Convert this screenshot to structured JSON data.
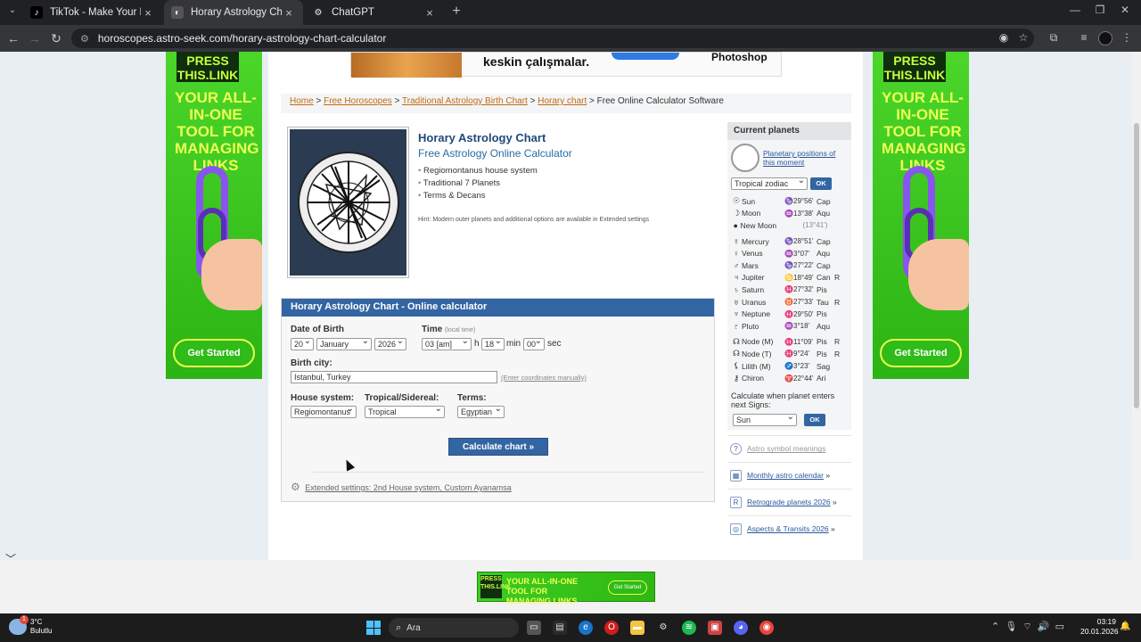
{
  "browser": {
    "tabs": [
      {
        "title": "TikTok - Make Your Day",
        "active": false
      },
      {
        "title": "Horary Astrology Chart Calculat",
        "active": true
      },
      {
        "title": "ChatGPT",
        "active": false
      }
    ],
    "url": "horoscopes.astro-seek.com/horary-astrology-chart-calculator"
  },
  "ads": {
    "side_brand": "PRESS THIS.LINK",
    "side_slogan": "YOUR ALL-IN-ONE TOOL FOR MANAGING LINKS",
    "side_cta": "Get Started",
    "top_text": "keskin çalışmalar.",
    "top_product": "Photoshop",
    "bottom_brand": "PRESS THIS.LINK",
    "bottom_slogan": "YOUR ALL-IN-ONE TOOL FOR MANAGING LINKS",
    "bottom_cta": "Get Started"
  },
  "breadcrumb": {
    "items": [
      "Home",
      "Free Horoscopes",
      "Traditional Astrology Birth Chart",
      "Horary chart"
    ],
    "current": "Free Online Calculator Software",
    "separator": ">"
  },
  "intro": {
    "title": "Horary Astrology Chart",
    "subtitle": "Free Astrology Online Calculator",
    "features": [
      "Regiomontanus house system",
      "Traditional 7 Planets",
      "Terms & Decans"
    ],
    "hint": "Hint: Modern outer planets and additional options are available in Extended settings"
  },
  "calculator": {
    "header": "Horary Astrology Chart - Online calculator",
    "date_label": "Date of Birth",
    "day": "20",
    "month": "January",
    "year": "2026",
    "time_label": "Time",
    "time_note": "(local time)",
    "hour": "03 [am]",
    "hour_unit": "h",
    "minute": "18",
    "minute_unit": "min",
    "second": "00",
    "second_unit": "sec",
    "city_label": "Birth city:",
    "city_value": "Istanbul, Turkey",
    "manual_link": "(Enter coordinates manually)",
    "house_label": "House system:",
    "house_value": "Regiomontanus",
    "tropical_label": "Tropical/Sidereal:",
    "tropical_value": "Tropical",
    "terms_label": "Terms:",
    "terms_value": "Egyptian",
    "submit": "Calculate chart »",
    "extended": "Extended settings: 2nd House system, Custom Ayanamsa"
  },
  "current_planets": {
    "heading": "Current planets",
    "positions_link": "Planetary positions of this moment",
    "zodiac_value": "Tropical zodiac",
    "ok": "OK",
    "planets": [
      {
        "symbol": "☉",
        "name": "Sun",
        "zsym": "♑",
        "deg": "29°56'",
        "sign": "Cap",
        "retro": ""
      },
      {
        "symbol": "☽",
        "name": "Moon",
        "zsym": "♒",
        "deg": "13°38'",
        "sign": "Aqu",
        "retro": ""
      },
      {
        "symbol": "●",
        "name": "New Moon",
        "zsym": "",
        "deg": "(13°41')",
        "sign": "",
        "retro": ""
      },
      {
        "symbol": "☿",
        "name": "Mercury",
        "zsym": "♑",
        "deg": "28°51'",
        "sign": "Cap",
        "retro": ""
      },
      {
        "symbol": "♀",
        "name": "Venus",
        "zsym": "♒",
        "deg": "3°07'",
        "sign": "Aqu",
        "retro": ""
      },
      {
        "symbol": "♂",
        "name": "Mars",
        "zsym": "♑",
        "deg": "27°22'",
        "sign": "Cap",
        "retro": ""
      },
      {
        "symbol": "♃",
        "name": "Jupiter",
        "zsym": "♋",
        "deg": "18°49'",
        "sign": "Can",
        "retro": "R"
      },
      {
        "symbol": "♄",
        "name": "Saturn",
        "zsym": "♓",
        "deg": "27°32'",
        "sign": "Pis",
        "retro": ""
      },
      {
        "symbol": "♅",
        "name": "Uranus",
        "zsym": "♉",
        "deg": "27°33'",
        "sign": "Tau",
        "retro": "R"
      },
      {
        "symbol": "♆",
        "name": "Neptune",
        "zsym": "♓",
        "deg": "29°50'",
        "sign": "Pis",
        "retro": ""
      },
      {
        "symbol": "♇",
        "name": "Pluto",
        "zsym": "♒",
        "deg": "3°18'",
        "sign": "Aqu",
        "retro": ""
      },
      {
        "symbol": "☊",
        "name": "Node (M)",
        "zsym": "♓",
        "deg": "11°09'",
        "sign": "Pis",
        "retro": "R"
      },
      {
        "symbol": "☊",
        "name": "Node (T)",
        "zsym": "♓",
        "deg": "9°24'",
        "sign": "Pis",
        "retro": "R"
      },
      {
        "symbol": "⚸",
        "name": "Lilith (M)",
        "zsym": "♐",
        "deg": "3°23'",
        "sign": "Sag",
        "retro": ""
      },
      {
        "symbol": "⚷",
        "name": "Chiron",
        "zsym": "♈",
        "deg": "22°44'",
        "sign": "Ari",
        "retro": ""
      }
    ],
    "notice": "Calculate when planet enters next Signs:",
    "planet_select": "Sun",
    "links": [
      {
        "icon": "?",
        "label": "Astro symbol meanings",
        "muted": true
      },
      {
        "icon": "▦",
        "label": "Monthly astro calendar",
        "muted": false
      },
      {
        "icon": "R",
        "label": "Retrograde planets 2026",
        "muted": false
      },
      {
        "icon": "◎",
        "label": "Aspects & Transits 2026",
        "muted": false
      }
    ]
  },
  "taskbar": {
    "temp": "3°C",
    "weather": "Bulutlu",
    "search_placeholder": "Ara",
    "time": "03:19",
    "date": "20.01.2026"
  }
}
